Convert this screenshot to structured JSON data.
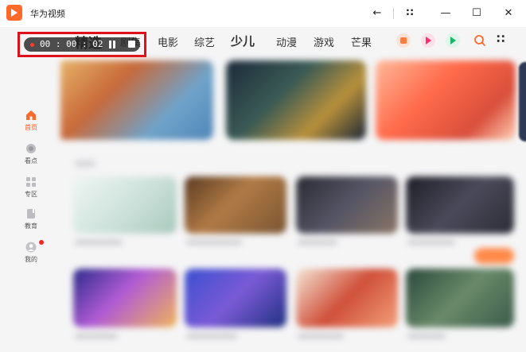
{
  "titlebar": {
    "app_title": "华为视频",
    "icons": [
      "back-icon",
      "grip-icon",
      "minimize-icon",
      "maximize-icon",
      "close-icon"
    ],
    "back_glyph": "←",
    "grip_glyph": "∷",
    "min_glyph": "—",
    "max_glyph": "☐",
    "close_glyph": "✕"
  },
  "nav": {
    "tabs": [
      "精选",
      "剧集",
      "电影",
      "综艺",
      "少儿",
      "动漫",
      "游戏",
      "芒果"
    ],
    "active": "精选",
    "right_icons": [
      "app-icon-orange",
      "app-icon-pink",
      "app-icon-green",
      "search-icon",
      "more-icon"
    ],
    "more_glyph": "∷"
  },
  "recorder": {
    "time": "00 : 00 : 02",
    "colors": {
      "frame": "#e0101a",
      "dot": "#ff3b30"
    }
  },
  "sidebar": {
    "items": [
      {
        "label": "首页",
        "icon": "home-icon",
        "active": true
      },
      {
        "label": "看点",
        "icon": "watch-icon",
        "active": false
      },
      {
        "label": "专区",
        "icon": "grid-icon",
        "active": false
      },
      {
        "label": "教育",
        "icon": "book-icon",
        "active": false
      },
      {
        "label": "我的",
        "icon": "avatar-icon",
        "active": false,
        "badge": true
      }
    ]
  },
  "colors": {
    "accent": "#ff5a1f",
    "brand": "#ff6a2b"
  }
}
